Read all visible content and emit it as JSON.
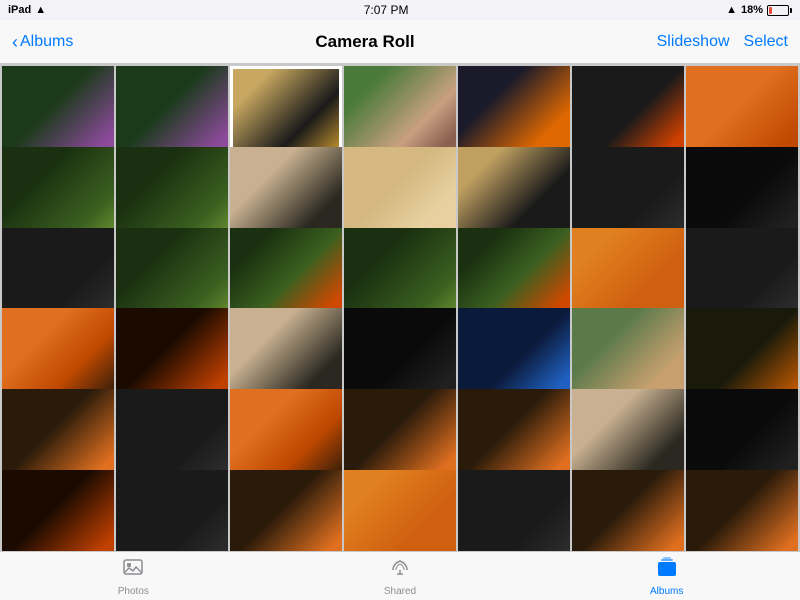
{
  "statusBar": {
    "left": "iPad",
    "time": "7:07 PM",
    "signal": "18%",
    "wifi": true
  },
  "navBar": {
    "backLabel": "Albums",
    "title": "Camera Roll",
    "slideshow": "Slideshow",
    "select": "Select"
  },
  "tabs": [
    {
      "id": "photos",
      "label": "Photos",
      "icon": "⬜",
      "active": false
    },
    {
      "id": "shared",
      "label": "Shared",
      "icon": "☁",
      "active": false
    },
    {
      "id": "albums",
      "label": "Albums",
      "icon": "⬛",
      "active": true
    }
  ],
  "photos": [
    {
      "id": 1,
      "theme": "theme-purple-plant",
      "selected": false
    },
    {
      "id": 2,
      "theme": "theme-purple-plant",
      "selected": false
    },
    {
      "id": 3,
      "theme": "theme-dark-insect",
      "selected": true
    },
    {
      "id": 4,
      "theme": "theme-family",
      "selected": false
    },
    {
      "id": 5,
      "theme": "theme-orange-petal",
      "selected": false
    },
    {
      "id": 6,
      "theme": "theme-dark-orange",
      "selected": false
    },
    {
      "id": 7,
      "theme": "theme-orange-bowl",
      "selected": false
    },
    {
      "id": 8,
      "theme": "theme-green-plant",
      "selected": false
    },
    {
      "id": 9,
      "theme": "theme-green-plant",
      "selected": false
    },
    {
      "id": 10,
      "theme": "theme-tan-bg",
      "selected": false
    },
    {
      "id": 11,
      "theme": "theme-tan-light",
      "selected": false
    },
    {
      "id": 12,
      "theme": "theme-tan-dark",
      "selected": false
    },
    {
      "id": 13,
      "theme": "theme-dark-ui",
      "selected": false
    },
    {
      "id": 14,
      "theme": "theme-dark-screen",
      "selected": false
    },
    {
      "id": 15,
      "theme": "theme-dark-ui",
      "selected": false
    },
    {
      "id": 16,
      "theme": "theme-green-plant",
      "selected": false
    },
    {
      "id": 17,
      "theme": "theme-green-flower",
      "selected": false
    },
    {
      "id": 18,
      "theme": "theme-green-plant",
      "selected": false
    },
    {
      "id": 19,
      "theme": "theme-green-flower",
      "selected": false
    },
    {
      "id": 20,
      "theme": "theme-orange-big",
      "selected": false
    },
    {
      "id": 21,
      "theme": "theme-dark-ui",
      "selected": false
    },
    {
      "id": 22,
      "theme": "theme-orange-grid",
      "selected": false
    },
    {
      "id": 23,
      "theme": "theme-orange-dark",
      "selected": false
    },
    {
      "id": 24,
      "theme": "theme-tan-bg",
      "selected": false
    },
    {
      "id": 25,
      "theme": "theme-dark-screen",
      "selected": false
    },
    {
      "id": 26,
      "theme": "theme-blue-ui",
      "selected": false
    },
    {
      "id": 27,
      "theme": "theme-photo-ui",
      "selected": false
    },
    {
      "id": 28,
      "theme": "theme-orange-ui",
      "selected": false
    },
    {
      "id": 29,
      "theme": "theme-orange-small",
      "selected": false
    },
    {
      "id": 30,
      "theme": "theme-dark-ui",
      "selected": false
    },
    {
      "id": 31,
      "theme": "theme-orange-grid",
      "selected": false
    },
    {
      "id": 32,
      "theme": "theme-orange-small",
      "selected": false
    },
    {
      "id": 33,
      "theme": "theme-orange-small",
      "selected": false
    },
    {
      "id": 34,
      "theme": "theme-tan-bg",
      "selected": false
    },
    {
      "id": 35,
      "theme": "theme-dark-screen",
      "selected": false
    },
    {
      "id": 36,
      "theme": "theme-orange-dark",
      "selected": false
    },
    {
      "id": 37,
      "theme": "theme-dark-ui",
      "selected": false
    },
    {
      "id": 38,
      "theme": "theme-orange-small",
      "selected": false
    },
    {
      "id": 39,
      "theme": "theme-orange-big",
      "selected": false
    },
    {
      "id": 40,
      "theme": "theme-dark-ui",
      "selected": false
    },
    {
      "id": 41,
      "theme": "theme-orange-small",
      "selected": false
    },
    {
      "id": 42,
      "theme": "theme-orange-small",
      "selected": false
    }
  ]
}
